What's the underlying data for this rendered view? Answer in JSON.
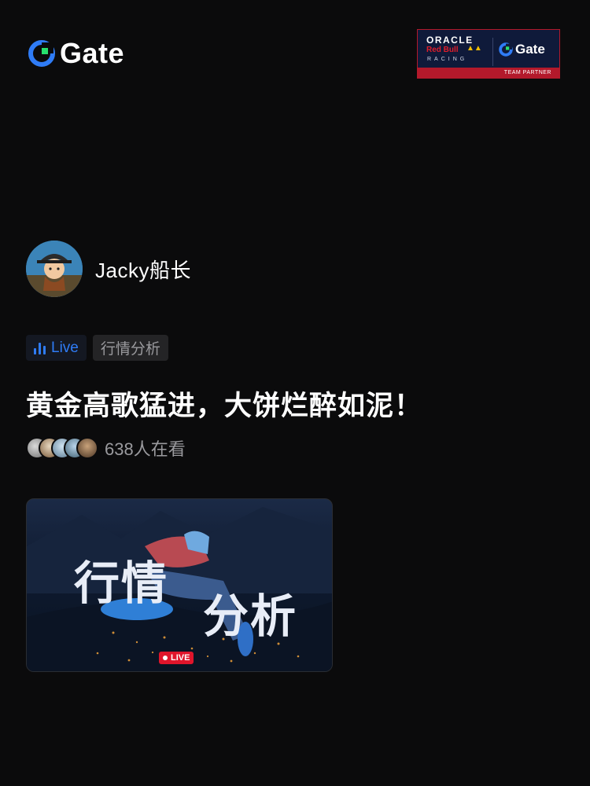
{
  "brand": {
    "name": "Gate"
  },
  "partner": {
    "oracle": "ORACLE",
    "redbull": "Red Bull",
    "racing": "RACING",
    "gate": "Gate",
    "band": "TEAM PARTNER"
  },
  "host": {
    "name": "Jacky船长"
  },
  "tags": {
    "live": "Live",
    "category": "行情分析"
  },
  "stream": {
    "title": "黄金高歌猛进，大饼烂醉如泥！",
    "viewer_count": "638人在看"
  },
  "cover": {
    "text_line1": "行情",
    "text_line2": "分析",
    "badge": "LIVE"
  },
  "colors": {
    "background": "#0b0b0c",
    "accent_blue": "#2f7cf6",
    "brand_green": "#27e06d",
    "live_red": "#e0152b"
  }
}
